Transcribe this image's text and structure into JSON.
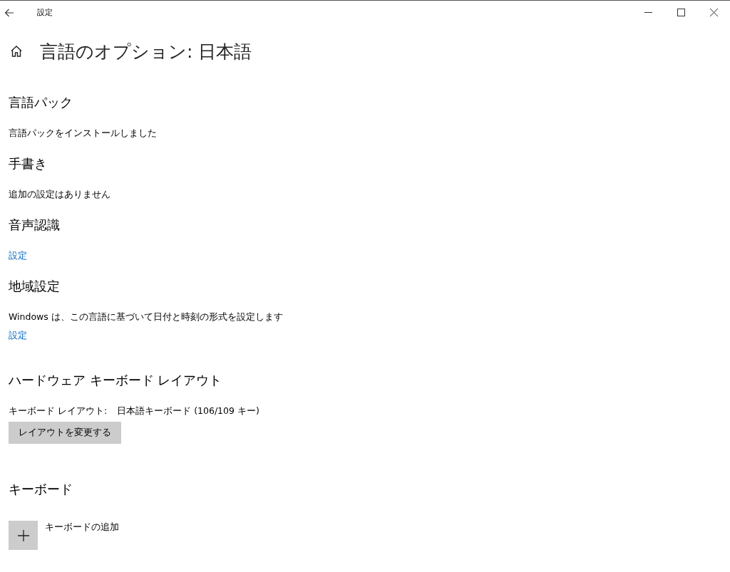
{
  "window": {
    "title": "設定"
  },
  "page_title": "言語のオプション: 日本語",
  "sections": [
    {
      "heading": "言語パック",
      "items": [
        {
          "kind": "text",
          "text": "言語パックをインストールしました"
        }
      ]
    },
    {
      "heading": "手書き",
      "items": [
        {
          "kind": "text",
          "text": "追加の設定はありません"
        }
      ]
    },
    {
      "heading": "音声認識",
      "items": [
        {
          "kind": "link",
          "text": "設定"
        }
      ]
    },
    {
      "heading": "地域設定",
      "items": [
        {
          "kind": "text",
          "text": "Windows は、この言語に基づいて日付と時刻の形式を設定します"
        },
        {
          "kind": "link",
          "text": "設定"
        }
      ]
    },
    {
      "heading": "ハードウェア キーボード レイアウト",
      "items": [
        {
          "kind": "pair",
          "label": "キーボード レイアウト:",
          "value": "日本語キーボード (106/109 キー)"
        },
        {
          "kind": "button",
          "text": "レイアウトを変更する"
        }
      ]
    },
    {
      "heading": "キーボード",
      "items": [
        {
          "kind": "add",
          "text": "キーボードの追加"
        }
      ]
    }
  ]
}
